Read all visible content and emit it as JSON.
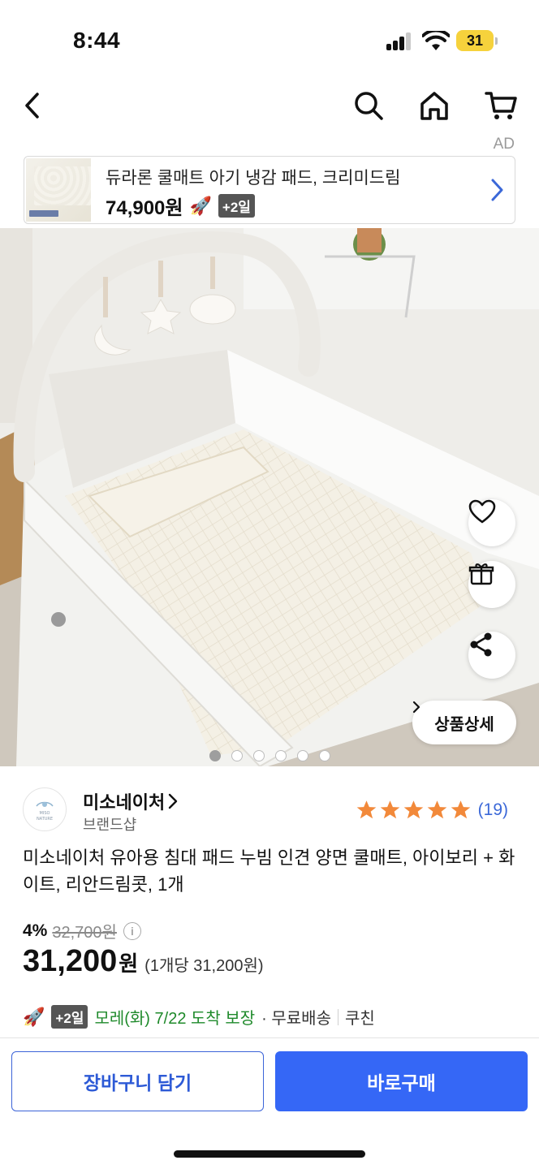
{
  "status_bar": {
    "time": "8:44",
    "battery": "31"
  },
  "nav": {
    "back": "back-arrow-icon",
    "search": "search-icon",
    "home": "home-icon",
    "cart": "cart-icon"
  },
  "ad": {
    "label": "AD",
    "title": "듀라론 쿨매트 아기 냉감 패드, 크리미드림",
    "price": "74,900원",
    "badge": "+2일"
  },
  "hero": {
    "detail_label": "상품상세",
    "image_count": 6,
    "active_index": 0
  },
  "brand": {
    "name": "미소네이처",
    "sub": "브랜드샵",
    "logo_text": "MISO NATURE",
    "rating_stars": 5,
    "rating_count": "(19)"
  },
  "product": {
    "title": "미소네이처 유아용 침대 패드 누빔 인견 양면 쿨매트, 아이보리 + 화이트, 리안드림콧, 1개",
    "discount": "4%",
    "original_price": "32,700원",
    "sale_price": "31,200",
    "sale_currency": "원",
    "per_unit": "(1개당 31,200원)"
  },
  "delivery": {
    "badge": "+2일",
    "main": "모레(화) 7/22 도착 보장",
    "free": "· 무료배송",
    "coupon": "쿠친"
  },
  "buttons": {
    "cart": "장바구니 담기",
    "buy": "바로구매"
  },
  "colors": {
    "accent": "#3567f6",
    "star": "#f2893a",
    "delivery": "#1f8a2b",
    "link": "#3b68d8"
  }
}
